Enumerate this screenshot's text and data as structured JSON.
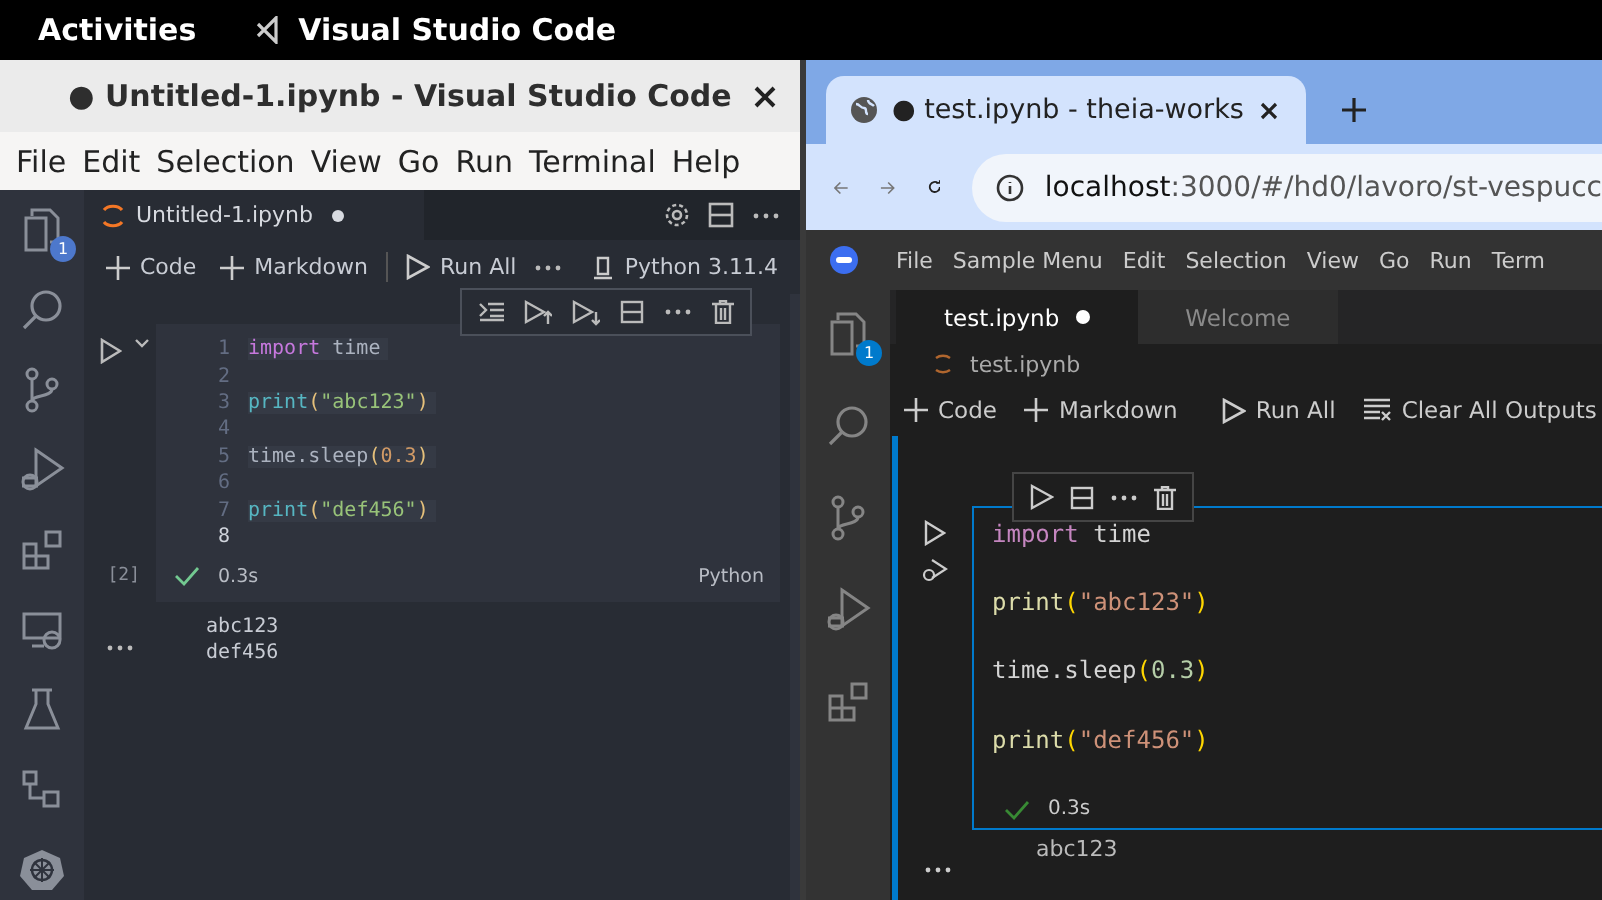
{
  "top_bar": {
    "activities": "Activities",
    "app_name": "Visual Studio Code"
  },
  "vscode": {
    "title": "● Untitled-1.ipynb - Visual Studio Code",
    "menu": [
      "File",
      "Edit",
      "Selection",
      "View",
      "Go",
      "Run",
      "Terminal",
      "Help"
    ],
    "explorer_badge": "1",
    "tab": {
      "label": "Untitled-1.ipynb",
      "dirty": true
    },
    "toolbar": [
      {
        "kind": "add",
        "label": "Code"
      },
      {
        "kind": "add",
        "label": "Markdown"
      },
      {
        "kind": "run",
        "label": "Run All"
      },
      {
        "kind": "more"
      }
    ],
    "kernel": "Python 3.11.4",
    "cell": {
      "lines": [
        {
          "number": "1",
          "current": false,
          "tokens": [
            {
              "text": "import",
              "kind": "keyword"
            },
            {
              "text": " time",
              "kind": "plain"
            }
          ]
        },
        {
          "number": "2",
          "current": false
        },
        {
          "number": "3",
          "current": false,
          "tokens": [
            {
              "text": "print",
              "kind": "func"
            },
            {
              "text": "(",
              "kind": "paren"
            },
            {
              "text": "\"abc123\"",
              "kind": "string"
            },
            {
              "text": ")",
              "kind": "paren"
            }
          ]
        },
        {
          "number": "4",
          "current": false
        },
        {
          "number": "5",
          "current": false,
          "tokens": [
            {
              "text": "time.sleep",
              "kind": "plain"
            },
            {
              "text": "(",
              "kind": "paren"
            },
            {
              "text": "0.3",
              "kind": "number"
            },
            {
              "text": ")",
              "kind": "paren"
            }
          ]
        },
        {
          "number": "6",
          "current": false
        },
        {
          "number": "7",
          "current": false,
          "tokens": [
            {
              "text": "print",
              "kind": "func"
            },
            {
              "text": "(",
              "kind": "paren"
            },
            {
              "text": "\"def456\"",
              "kind": "string"
            },
            {
              "text": ")",
              "kind": "paren"
            }
          ]
        },
        {
          "number": "8",
          "current": true
        }
      ],
      "exec_count": "[2]",
      "time": "0.3s",
      "language": "Python"
    },
    "output": [
      "abc123",
      "def456"
    ]
  },
  "browser": {
    "tab_title": "● test.ipynb - theia-works",
    "url_host": "localhost",
    "url_rest": ":3000/#/hd0/lavoro/st-vespucc",
    "theia_menu": [
      "File",
      "Sample Menu",
      "Edit",
      "Selection",
      "View",
      "Go",
      "Run",
      "Term"
    ],
    "explorer_badge": "1",
    "tabs": [
      {
        "label": "test.ipynb",
        "selected": true,
        "dirty": true
      },
      {
        "label": "Welcome",
        "selected": false,
        "dirty": false
      }
    ],
    "breadcrumb": "test.ipynb",
    "toolbar": [
      {
        "kind": "add",
        "label": "Code"
      },
      {
        "kind": "add",
        "label": "Markdown"
      },
      {
        "kind": "run",
        "label": "Run All"
      },
      {
        "kind": "clear",
        "label": "Clear All Outputs"
      }
    ],
    "cell": {
      "lines": [
        {
          "kind": "code",
          "tokens": [
            {
              "text": "import",
              "kind": "keyword"
            },
            {
              "text": " time",
              "kind": "plain"
            }
          ]
        },
        {
          "kind": "blank"
        },
        {
          "kind": "code",
          "tokens": [
            {
              "text": "print",
              "kind": "func"
            },
            {
              "text": "(",
              "kind": "paren"
            },
            {
              "text": "\"abc123\"",
              "kind": "string"
            },
            {
              "text": ")",
              "kind": "paren"
            }
          ]
        },
        {
          "kind": "blank"
        },
        {
          "kind": "code",
          "tokens": [
            {
              "text": "time.sleep",
              "kind": "plain"
            },
            {
              "text": "(",
              "kind": "paren"
            },
            {
              "text": "0.3",
              "kind": "number"
            },
            {
              "text": ")",
              "kind": "paren"
            }
          ]
        },
        {
          "kind": "blank"
        },
        {
          "kind": "code",
          "tokens": [
            {
              "text": "print",
              "kind": "func"
            },
            {
              "text": "(",
              "kind": "paren"
            },
            {
              "text": "\"def456\"",
              "kind": "string"
            },
            {
              "text": ")",
              "kind": "paren"
            }
          ]
        },
        {
          "kind": "blank"
        }
      ],
      "time": "0.3s"
    },
    "output": [
      "abc123"
    ]
  }
}
